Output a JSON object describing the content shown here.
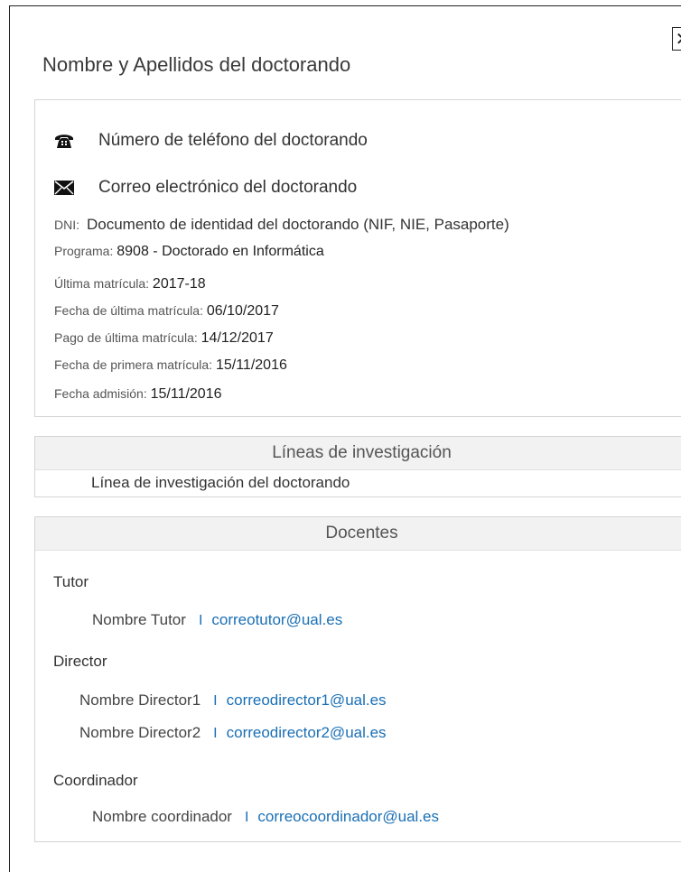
{
  "dialog": {
    "title": "Nombre y Apellidos del doctorando",
    "close_label": "✕"
  },
  "contact": {
    "phone": "Número de teléfono del doctorando",
    "email": "Correo electrónico del doctorando",
    "phone_icon": "phone-icon",
    "email_icon": "envelope-icon"
  },
  "details": {
    "dni_label": "DNI:",
    "dni_value": "Documento de identidad del doctorando (NIF, NIE, Pasaporte)",
    "programa_label": "Programa:",
    "programa_value": "8908 - Doctorado en Informática",
    "ultima_label": "Última matrícula:",
    "ultima_value": "2017-18",
    "fecha_ultima_label": "Fecha de última matrícula:",
    "fecha_ultima_value": "06/10/2017",
    "pago_label": "Pago de última matrícula:",
    "pago_value": "14/12/2017",
    "primera_label": "Fecha de primera matrícula:",
    "primera_value": "15/11/2016",
    "admision_label": "Fecha admisión:",
    "admision_value": "15/11/2016"
  },
  "lineas": {
    "header": "Líneas de investigación",
    "item": "Línea de investigación del doctorando"
  },
  "docentes": {
    "header": "Docentes",
    "separator": "I",
    "tutor": {
      "label": "Tutor",
      "name": "Nombre Tutor",
      "email": "correotutor@ual.es"
    },
    "director": {
      "label": "Director",
      "people": [
        {
          "name": "Nombre Director1",
          "email": "correodirector1@ual.es"
        },
        {
          "name": "Nombre Director2",
          "email": "correodirector2@ual.es"
        }
      ]
    },
    "coordinador": {
      "label": "Coordinador",
      "name": "Nombre coordinador",
      "email": "correocoordinador@ual.es"
    }
  },
  "colors": {
    "link": "#1a6fb5",
    "panel_header_bg": "#f2f2f2",
    "border": "#d4d4d4"
  }
}
